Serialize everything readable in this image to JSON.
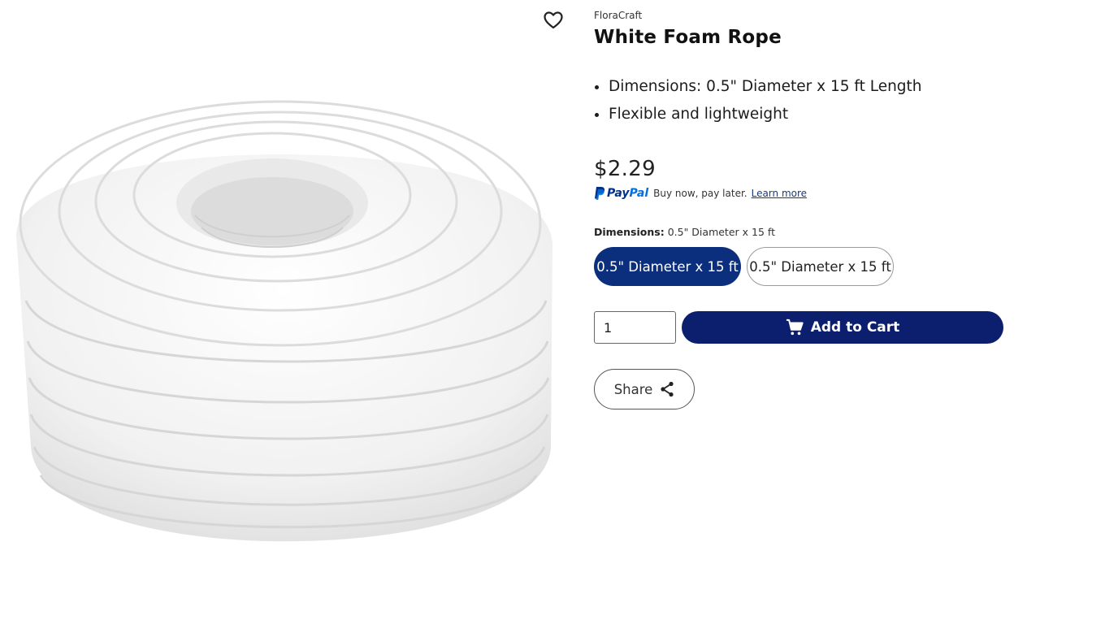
{
  "product": {
    "brand": "FloraCraft",
    "title": "White Foam Rope",
    "bullets": [
      "Dimensions: 0.5\" Diameter x 15 ft Length",
      "Flexible and lightweight"
    ],
    "price": "$2.29",
    "image_icon": "coiled-white-foam-rope-image"
  },
  "paypal": {
    "logo_left": "Pay",
    "logo_right": "Pal",
    "text": "Buy now, pay later.",
    "link": "Learn more"
  },
  "dimensions": {
    "label": "Dimensions:",
    "selected_value": "0.5\" Diameter x 15 ft",
    "options": [
      {
        "label": "0.5\" Diameter x 15 ft",
        "selected": true
      },
      {
        "label": "0.5\" Diameter x 15 ft",
        "selected": false
      }
    ]
  },
  "purchase": {
    "quantity": "1",
    "add_to_cart": "Add to Cart",
    "share": "Share"
  },
  "colors": {
    "selected_option": "#0b2f7d",
    "add_to_cart": "#0c1f6e",
    "paypal_dark": "#003087",
    "paypal_light": "#0070e0"
  },
  "icons": {
    "wishlist": "heart-outline-icon",
    "cart": "cart-icon",
    "share": "share-icon"
  }
}
